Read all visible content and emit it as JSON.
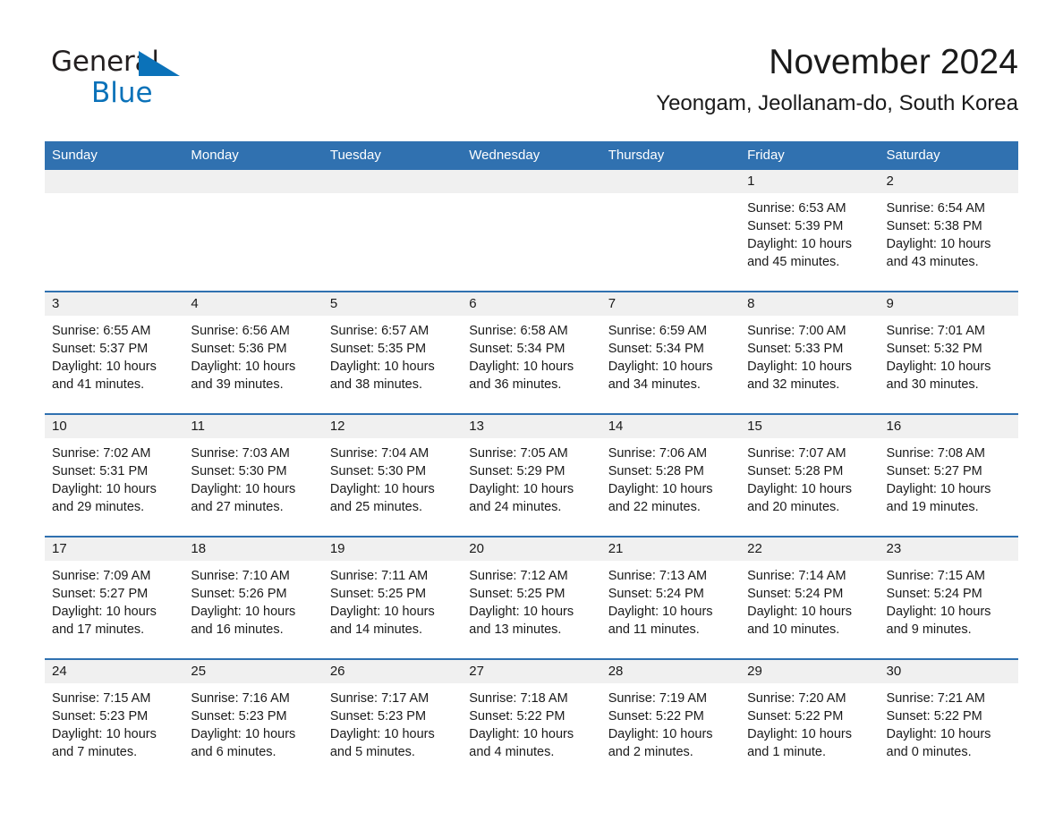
{
  "brand": {
    "word1": "General",
    "word2": "Blue",
    "triangle_color": "#0b72b9",
    "text_color": "#231f20",
    "icon": "triangle-logo-icon"
  },
  "header": {
    "month_title": "November 2024",
    "location": "Yeongam, Jeollanam-do, South Korea"
  },
  "colors": {
    "header_blue": "#3071b0",
    "daynum_band": "#f0f0f0",
    "text": "#1a1a1a",
    "brand_blue": "#0b72b9"
  },
  "calendar": {
    "weekday_headers": [
      "Sunday",
      "Monday",
      "Tuesday",
      "Wednesday",
      "Thursday",
      "Friday",
      "Saturday"
    ],
    "labels": {
      "sunrise_prefix": "Sunrise:",
      "sunset_prefix": "Sunset:",
      "daylight_prefix": "Daylight:"
    },
    "weeks": [
      [
        {
          "day": "",
          "blank": true
        },
        {
          "day": "",
          "blank": true
        },
        {
          "day": "",
          "blank": true
        },
        {
          "day": "",
          "blank": true
        },
        {
          "day": "",
          "blank": true
        },
        {
          "day": "1",
          "sunrise": "Sunrise: 6:53 AM",
          "sunset": "Sunset: 5:39 PM",
          "daylight_l1": "Daylight: 10 hours",
          "daylight_l2": "and 45 minutes."
        },
        {
          "day": "2",
          "sunrise": "Sunrise: 6:54 AM",
          "sunset": "Sunset: 5:38 PM",
          "daylight_l1": "Daylight: 10 hours",
          "daylight_l2": "and 43 minutes."
        }
      ],
      [
        {
          "day": "3",
          "sunrise": "Sunrise: 6:55 AM",
          "sunset": "Sunset: 5:37 PM",
          "daylight_l1": "Daylight: 10 hours",
          "daylight_l2": "and 41 minutes."
        },
        {
          "day": "4",
          "sunrise": "Sunrise: 6:56 AM",
          "sunset": "Sunset: 5:36 PM",
          "daylight_l1": "Daylight: 10 hours",
          "daylight_l2": "and 39 minutes."
        },
        {
          "day": "5",
          "sunrise": "Sunrise: 6:57 AM",
          "sunset": "Sunset: 5:35 PM",
          "daylight_l1": "Daylight: 10 hours",
          "daylight_l2": "and 38 minutes."
        },
        {
          "day": "6",
          "sunrise": "Sunrise: 6:58 AM",
          "sunset": "Sunset: 5:34 PM",
          "daylight_l1": "Daylight: 10 hours",
          "daylight_l2": "and 36 minutes."
        },
        {
          "day": "7",
          "sunrise": "Sunrise: 6:59 AM",
          "sunset": "Sunset: 5:34 PM",
          "daylight_l1": "Daylight: 10 hours",
          "daylight_l2": "and 34 minutes."
        },
        {
          "day": "8",
          "sunrise": "Sunrise: 7:00 AM",
          "sunset": "Sunset: 5:33 PM",
          "daylight_l1": "Daylight: 10 hours",
          "daylight_l2": "and 32 minutes."
        },
        {
          "day": "9",
          "sunrise": "Sunrise: 7:01 AM",
          "sunset": "Sunset: 5:32 PM",
          "daylight_l1": "Daylight: 10 hours",
          "daylight_l2": "and 30 minutes."
        }
      ],
      [
        {
          "day": "10",
          "sunrise": "Sunrise: 7:02 AM",
          "sunset": "Sunset: 5:31 PM",
          "daylight_l1": "Daylight: 10 hours",
          "daylight_l2": "and 29 minutes."
        },
        {
          "day": "11",
          "sunrise": "Sunrise: 7:03 AM",
          "sunset": "Sunset: 5:30 PM",
          "daylight_l1": "Daylight: 10 hours",
          "daylight_l2": "and 27 minutes."
        },
        {
          "day": "12",
          "sunrise": "Sunrise: 7:04 AM",
          "sunset": "Sunset: 5:30 PM",
          "daylight_l1": "Daylight: 10 hours",
          "daylight_l2": "and 25 minutes."
        },
        {
          "day": "13",
          "sunrise": "Sunrise: 7:05 AM",
          "sunset": "Sunset: 5:29 PM",
          "daylight_l1": "Daylight: 10 hours",
          "daylight_l2": "and 24 minutes."
        },
        {
          "day": "14",
          "sunrise": "Sunrise: 7:06 AM",
          "sunset": "Sunset: 5:28 PM",
          "daylight_l1": "Daylight: 10 hours",
          "daylight_l2": "and 22 minutes."
        },
        {
          "day": "15",
          "sunrise": "Sunrise: 7:07 AM",
          "sunset": "Sunset: 5:28 PM",
          "daylight_l1": "Daylight: 10 hours",
          "daylight_l2": "and 20 minutes."
        },
        {
          "day": "16",
          "sunrise": "Sunrise: 7:08 AM",
          "sunset": "Sunset: 5:27 PM",
          "daylight_l1": "Daylight: 10 hours",
          "daylight_l2": "and 19 minutes."
        }
      ],
      [
        {
          "day": "17",
          "sunrise": "Sunrise: 7:09 AM",
          "sunset": "Sunset: 5:27 PM",
          "daylight_l1": "Daylight: 10 hours",
          "daylight_l2": "and 17 minutes."
        },
        {
          "day": "18",
          "sunrise": "Sunrise: 7:10 AM",
          "sunset": "Sunset: 5:26 PM",
          "daylight_l1": "Daylight: 10 hours",
          "daylight_l2": "and 16 minutes."
        },
        {
          "day": "19",
          "sunrise": "Sunrise: 7:11 AM",
          "sunset": "Sunset: 5:25 PM",
          "daylight_l1": "Daylight: 10 hours",
          "daylight_l2": "and 14 minutes."
        },
        {
          "day": "20",
          "sunrise": "Sunrise: 7:12 AM",
          "sunset": "Sunset: 5:25 PM",
          "daylight_l1": "Daylight: 10 hours",
          "daylight_l2": "and 13 minutes."
        },
        {
          "day": "21",
          "sunrise": "Sunrise: 7:13 AM",
          "sunset": "Sunset: 5:24 PM",
          "daylight_l1": "Daylight: 10 hours",
          "daylight_l2": "and 11 minutes."
        },
        {
          "day": "22",
          "sunrise": "Sunrise: 7:14 AM",
          "sunset": "Sunset: 5:24 PM",
          "daylight_l1": "Daylight: 10 hours",
          "daylight_l2": "and 10 minutes."
        },
        {
          "day": "23",
          "sunrise": "Sunrise: 7:15 AM",
          "sunset": "Sunset: 5:24 PM",
          "daylight_l1": "Daylight: 10 hours",
          "daylight_l2": "and 9 minutes."
        }
      ],
      [
        {
          "day": "24",
          "sunrise": "Sunrise: 7:15 AM",
          "sunset": "Sunset: 5:23 PM",
          "daylight_l1": "Daylight: 10 hours",
          "daylight_l2": "and 7 minutes."
        },
        {
          "day": "25",
          "sunrise": "Sunrise: 7:16 AM",
          "sunset": "Sunset: 5:23 PM",
          "daylight_l1": "Daylight: 10 hours",
          "daylight_l2": "and 6 minutes."
        },
        {
          "day": "26",
          "sunrise": "Sunrise: 7:17 AM",
          "sunset": "Sunset: 5:23 PM",
          "daylight_l1": "Daylight: 10 hours",
          "daylight_l2": "and 5 minutes."
        },
        {
          "day": "27",
          "sunrise": "Sunrise: 7:18 AM",
          "sunset": "Sunset: 5:22 PM",
          "daylight_l1": "Daylight: 10 hours",
          "daylight_l2": "and 4 minutes."
        },
        {
          "day": "28",
          "sunrise": "Sunrise: 7:19 AM",
          "sunset": "Sunset: 5:22 PM",
          "daylight_l1": "Daylight: 10 hours",
          "daylight_l2": "and 2 minutes."
        },
        {
          "day": "29",
          "sunrise": "Sunrise: 7:20 AM",
          "sunset": "Sunset: 5:22 PM",
          "daylight_l1": "Daylight: 10 hours",
          "daylight_l2": "and 1 minute."
        },
        {
          "day": "30",
          "sunrise": "Sunrise: 7:21 AM",
          "sunset": "Sunset: 5:22 PM",
          "daylight_l1": "Daylight: 10 hours",
          "daylight_l2": "and 0 minutes."
        }
      ]
    ]
  }
}
